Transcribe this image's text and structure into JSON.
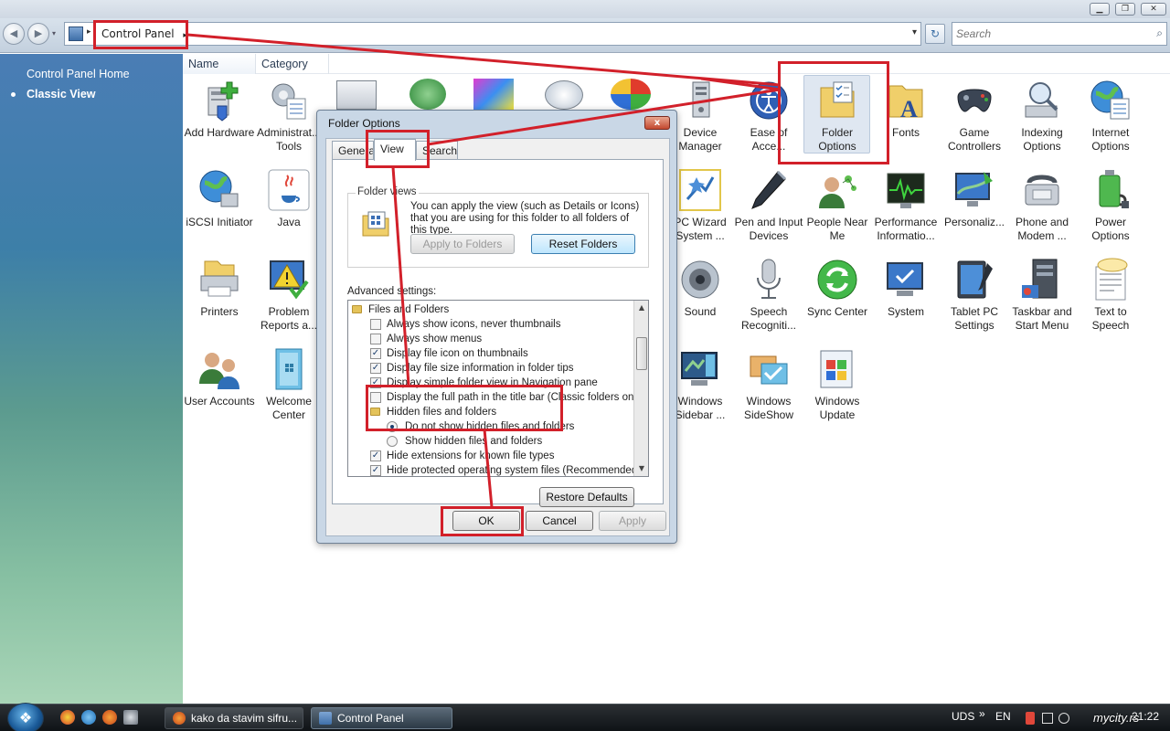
{
  "window": {
    "minimize_glyph": "▁",
    "maximize_glyph": "❐",
    "close_glyph": "✕"
  },
  "address": {
    "crumb": "Control Panel",
    "search_placeholder": "Search",
    "back_glyph": "◀",
    "forward_glyph": "▶",
    "refresh_glyph": "↻",
    "dropdown_glyph": "▾",
    "crumb_arrow": "▸",
    "search_glyph": "⌕"
  },
  "sidebar": {
    "items": [
      {
        "label": "Control Panel Home"
      },
      {
        "label": "Classic View"
      }
    ]
  },
  "columns": [
    "Name",
    "Category"
  ],
  "items": [
    {
      "label": "Add Hardware",
      "icon": "add-hardware-icon"
    },
    {
      "label": "Administrat... Tools",
      "icon": "administrative-tools-icon"
    },
    {
      "label": "Device Manager",
      "icon": "device-manager-icon"
    },
    {
      "label": "Ease of Acce...",
      "icon": "ease-of-access-icon"
    },
    {
      "label": "Folder Options",
      "icon": "folder-options-icon"
    },
    {
      "label": "Fonts",
      "icon": "fonts-icon"
    },
    {
      "label": "Game Controllers",
      "icon": "game-controllers-icon"
    },
    {
      "label": "Indexing Options",
      "icon": "indexing-options-icon"
    },
    {
      "label": "Internet Options",
      "icon": "internet-options-icon"
    },
    {
      "label": "iSCSI Initiator",
      "icon": "iscsi-initiator-icon"
    },
    {
      "label": "Java",
      "icon": "java-icon"
    },
    {
      "label": "PC Wizard System ...",
      "icon": "pc-wizard-icon"
    },
    {
      "label": "Pen and Input Devices",
      "icon": "pen-input-icon"
    },
    {
      "label": "People Near Me",
      "icon": "people-near-me-icon"
    },
    {
      "label": "Performance Informatio...",
      "icon": "performance-icon"
    },
    {
      "label": "Personaliz...",
      "icon": "personalization-icon"
    },
    {
      "label": "Phone and Modem ...",
      "icon": "phone-modem-icon"
    },
    {
      "label": "Power Options",
      "icon": "power-options-icon"
    },
    {
      "label": "Printers",
      "icon": "printers-icon"
    },
    {
      "label": "Problem Reports a...",
      "icon": "problem-reports-icon"
    },
    {
      "label": "Sound",
      "icon": "sound-icon"
    },
    {
      "label": "Speech Recogniti...",
      "icon": "speech-recognition-icon"
    },
    {
      "label": "Sync Center",
      "icon": "sync-center-icon"
    },
    {
      "label": "System",
      "icon": "system-icon"
    },
    {
      "label": "Tablet PC Settings",
      "icon": "tablet-pc-icon"
    },
    {
      "label": "Taskbar and Start Menu",
      "icon": "taskbar-start-icon"
    },
    {
      "label": "Text to Speech",
      "icon": "text-to-speech-icon"
    },
    {
      "label": "User Accounts",
      "icon": "user-accounts-icon"
    },
    {
      "label": "Welcome Center",
      "icon": "welcome-center-icon"
    },
    {
      "label": "Windows Sidebar ...",
      "icon": "windows-sidebar-icon"
    },
    {
      "label": "Windows SideShow",
      "icon": "windows-sideshow-icon"
    },
    {
      "label": "Windows Update",
      "icon": "windows-update-icon"
    }
  ],
  "dialog": {
    "title": "Folder Options",
    "close_glyph": "x",
    "tabs": [
      "General",
      "View",
      "Search"
    ],
    "folder_views": {
      "legend": "Folder views",
      "description": "You can apply the view (such as Details or Icons) that you are using for this folder to all folders of this type.",
      "apply_label": "Apply to Folders",
      "reset_label": "Reset Folders"
    },
    "advanced_label": "Advanced settings:",
    "tree": [
      {
        "type": "folder",
        "label": "Files and Folders"
      },
      {
        "type": "check",
        "label": "Always show icons, never thumbnails",
        "checked": false
      },
      {
        "type": "check",
        "label": "Always show menus",
        "checked": false
      },
      {
        "type": "check",
        "label": "Display file icon on thumbnails",
        "checked": true
      },
      {
        "type": "check",
        "label": "Display file size information in folder tips",
        "checked": true
      },
      {
        "type": "check",
        "label": "Display simple folder view in Navigation pane",
        "checked": true
      },
      {
        "type": "check",
        "label": "Display the full path in the title bar (Classic folders only)",
        "checked": false
      },
      {
        "type": "folder2",
        "label": "Hidden files and folders"
      },
      {
        "type": "radio",
        "label": "Do not show hidden files and folders",
        "checked": true
      },
      {
        "type": "radio",
        "label": "Show hidden files and folders",
        "checked": false
      },
      {
        "type": "check",
        "label": "Hide extensions for known file types",
        "checked": true
      },
      {
        "type": "check",
        "label": "Hide protected operating system files (Recommended)",
        "checked": true
      }
    ],
    "restore_label": "Restore Defaults",
    "ok_label": "OK",
    "cancel_label": "Cancel",
    "apply_label": "Apply",
    "check_glyph": "✓",
    "scroll_up_glyph": "▲",
    "scroll_down_glyph": "▼"
  },
  "taskbar": {
    "tasks": [
      {
        "label": "kako da stavim sifru..."
      },
      {
        "label": "Control Panel"
      }
    ],
    "start_glyph": "❖",
    "tray": {
      "uds": "UDS",
      "more": "»",
      "lang": "EN",
      "time": "21:22"
    }
  },
  "watermark": "mycity.rs",
  "colors": {
    "annotation": "#d2202a"
  }
}
